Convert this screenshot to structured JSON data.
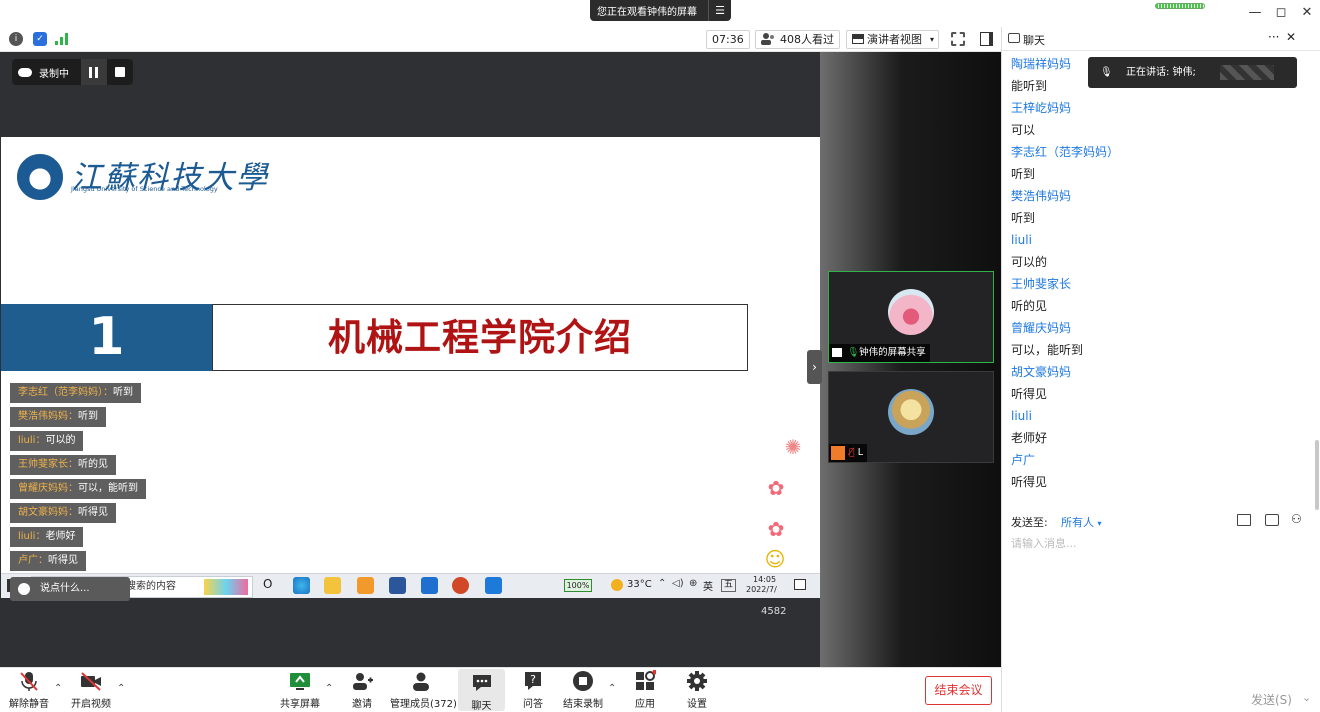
{
  "window": {
    "share_banner": "您正在观看钟伟的屏幕",
    "banner_menu_glyph": "☰",
    "controls": {
      "minimize": "—",
      "maximize": "◻",
      "close": "✕"
    }
  },
  "infobar": {
    "timer": "07:36",
    "viewers": "408人看过",
    "view_mode": "演讲者视图"
  },
  "recording": {
    "label": "录制中"
  },
  "slide": {
    "university_cn": "江蘇科技大學",
    "university_en": "Jiangsu University of Science and Technology",
    "section_number": "1",
    "section_title": "机械工程学院介绍",
    "colors": {
      "brand_blue": "#1e5d8d",
      "title_red": "#b01313"
    }
  },
  "danmu": [
    {
      "name": "李志红（范李妈妈）：",
      "text": "听到"
    },
    {
      "name": "樊浩伟妈妈：",
      "text": "听到"
    },
    {
      "name": "liuli：",
      "text": "可以的"
    },
    {
      "name": "王帅斐家长：",
      "text": "听的见"
    },
    {
      "name": "曾耀庆妈妈：",
      "text": "可以，能听到"
    },
    {
      "name": "胡文豪妈妈：",
      "text": "听得见"
    },
    {
      "name": "liuli：",
      "text": "老师好"
    },
    {
      "name": "卢广：",
      "text": "听得见"
    }
  ],
  "comment_box": {
    "placeholder": "说点什么..."
  },
  "taskbar": {
    "search_placeholder": "在这里输入你要搜索的内容",
    "battery": "100%",
    "temperature": "33°C",
    "ime": "英",
    "ime2": "五",
    "time": "14:05",
    "date": "2022/7/",
    "cortana": "O"
  },
  "stage_counter": "4582",
  "participants": [
    {
      "label": "钟伟的屏幕共享"
    },
    {
      "label": "L"
    }
  ],
  "toolbar": {
    "mute": "解除静音",
    "video": "开启视频",
    "share": "共享屏幕",
    "invite": "邀请",
    "members": "管理成员(372)",
    "chat": "聊天",
    "qa": "问答",
    "end_record": "结束录制",
    "apps": "应用",
    "settings": "设置",
    "end_meeting": "结束会议"
  },
  "chat": {
    "title": "聊天",
    "more": "···",
    "speaking": "正在讲话: 钟伟;",
    "messages": [
      {
        "name": "陶瑞祥妈妈",
        "text": "能听到"
      },
      {
        "name": "王梓屹妈妈",
        "text": "可以"
      },
      {
        "name": "李志红（范李妈妈）",
        "text": "听到"
      },
      {
        "name": "樊浩伟妈妈",
        "text": "听到"
      },
      {
        "name": "liuli",
        "text": "可以的"
      },
      {
        "name": "王帅斐家长",
        "text": "听的见"
      },
      {
        "name": "曾耀庆妈妈",
        "text": "可以，能听到"
      },
      {
        "name": "胡文豪妈妈",
        "text": "听得见"
      },
      {
        "name": "liuli",
        "text": "老师好"
      },
      {
        "name": "卢广",
        "text": "听得见"
      }
    ],
    "send_to_label": "发送至:",
    "send_to_value": "所有人",
    "input_placeholder": "请输入消息...",
    "send_button": "发送(S)"
  }
}
